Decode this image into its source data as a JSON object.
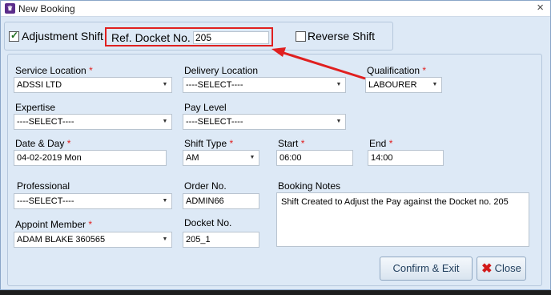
{
  "window": {
    "title": "New Booking",
    "close_glyph": "×"
  },
  "top": {
    "adjustment_shift_label": "Adjustment Shift",
    "adjustment_shift_checked": true,
    "ref_docket_label": "Ref. Docket No.",
    "ref_docket_value": "205",
    "reverse_shift_label": "Reverse Shift",
    "reverse_shift_checked": false
  },
  "form": {
    "service_location": {
      "label": "Service Location",
      "required": "*",
      "value": "ADSSI LTD"
    },
    "delivery_location": {
      "label": "Delivery Location",
      "value": "----SELECT----"
    },
    "qualification": {
      "label": "Qualification",
      "required": "*",
      "value": "LABOURER"
    },
    "expertise": {
      "label": "Expertise",
      "value": "----SELECT----"
    },
    "pay_level": {
      "label": "Pay Level",
      "value": "----SELECT----"
    },
    "date_day": {
      "label": "Date & Day",
      "required": "*",
      "value": "04-02-2019 Mon"
    },
    "shift_type": {
      "label": "Shift Type",
      "required": "*",
      "value": "AM"
    },
    "start": {
      "label": "Start",
      "required": "*",
      "value": "06:00"
    },
    "end": {
      "label": "End",
      "required": "*",
      "value": "14:00"
    },
    "professional": {
      "label": "Professional",
      "value": "----SELECT----"
    },
    "order_no": {
      "label": "Order No.",
      "value": "ADMIN66"
    },
    "booking_notes": {
      "label": "Booking Notes",
      "value": "Shift Created to Adjust the Pay against the Docket no. 205"
    },
    "appoint_member": {
      "label": "Appoint Member",
      "required": "*",
      "value": "ADAM BLAKE 360565"
    },
    "docket_no": {
      "label": "Docket No.",
      "value": "205_1"
    }
  },
  "buttons": {
    "confirm_exit": "Confirm & Exit",
    "close": "Close"
  },
  "colors": {
    "annotation": "#e02020",
    "required": "#e02020",
    "panel_bg": "#dde9f6"
  }
}
